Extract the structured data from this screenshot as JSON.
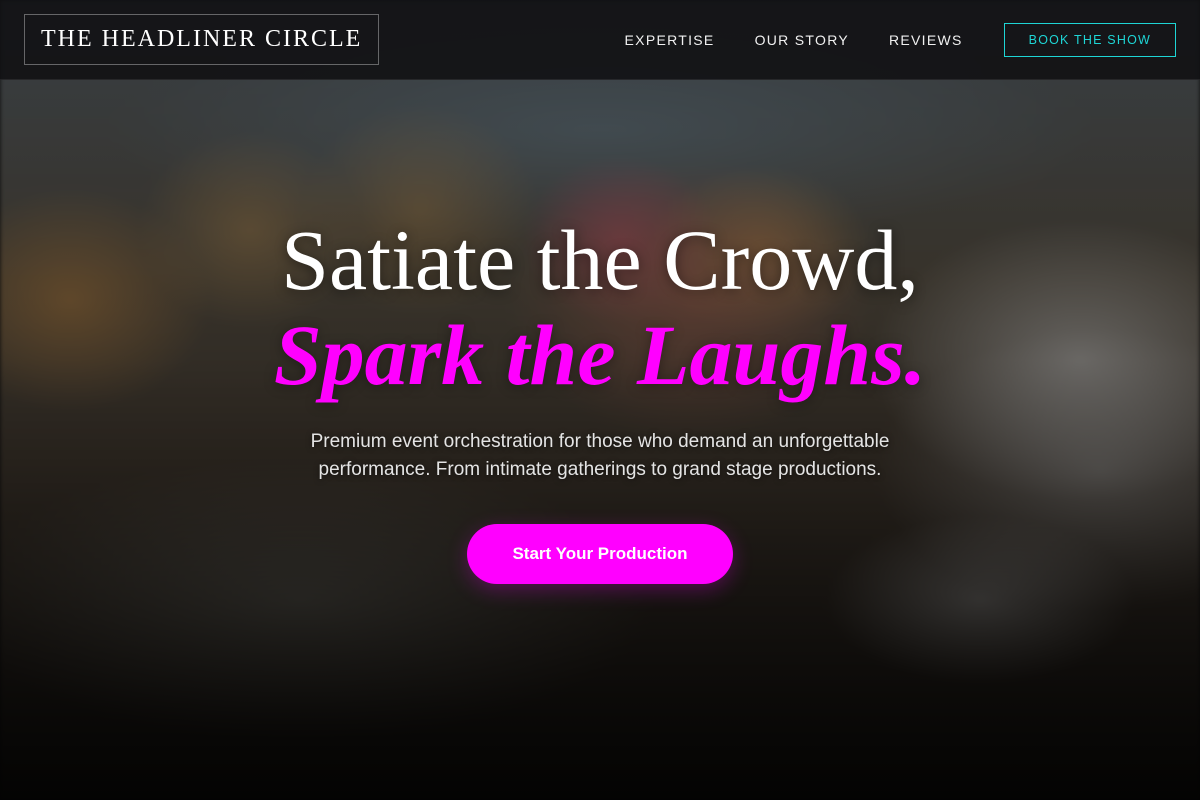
{
  "header": {
    "logo": "THE HEADLINER CIRCLE",
    "nav": [
      {
        "label": "EXPERTISE"
      },
      {
        "label": "OUR STORY"
      },
      {
        "label": "REVIEWS"
      }
    ],
    "cta": "BOOK THE SHOW"
  },
  "hero": {
    "headline_line1": "Satiate the Crowd,",
    "headline_line2": "Spark the Laughs.",
    "subtitle": "Premium event orchestration for those who demand an unforgettable performance. From intimate gatherings to grand stage productions.",
    "cta": "Start Your Production"
  },
  "colors": {
    "accent_magenta": "#ff00ff",
    "accent_cyan": "#1ed5d5",
    "header_bg": "#101012"
  }
}
